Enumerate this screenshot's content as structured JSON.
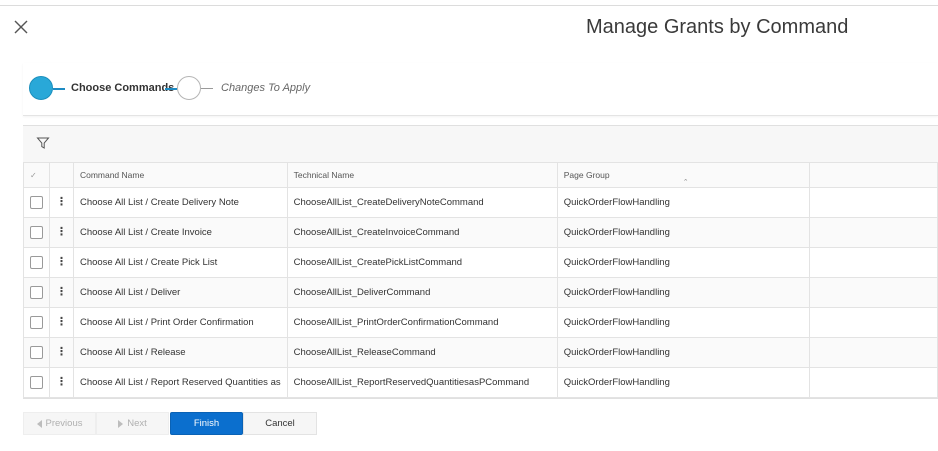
{
  "dialog": {
    "title": "Manage Grants by Command"
  },
  "stepper": {
    "steps": [
      {
        "label": "Choose Commands",
        "state": "active"
      },
      {
        "label": "Changes To Apply",
        "state": "pending"
      }
    ],
    "active_color": "#29a8d8"
  },
  "grid": {
    "columns": {
      "select": "✓",
      "command_name": "Command Name",
      "technical_name": "Technical Name",
      "page_group": "Page Group"
    },
    "sorted_column": "page_group",
    "sort_direction": "ascending",
    "rows": [
      {
        "command": "Choose All List / Create Delivery Note",
        "technical": "ChooseAllList_CreateDeliveryNoteCommand",
        "group": "QuickOrderFlowHandling"
      },
      {
        "command": "Choose All List / Create Invoice",
        "technical": "ChooseAllList_CreateInvoiceCommand",
        "group": "QuickOrderFlowHandling"
      },
      {
        "command": "Choose All List / Create Pick List",
        "technical": "ChooseAllList_CreatePickListCommand",
        "group": "QuickOrderFlowHandling"
      },
      {
        "command": "Choose All List / Deliver",
        "technical": "ChooseAllList_DeliverCommand",
        "group": "QuickOrderFlowHandling"
      },
      {
        "command": "Choose All List / Print Order Confirmation",
        "technical": "ChooseAllList_PrintOrderConfirmationCommand",
        "group": "QuickOrderFlowHandling"
      },
      {
        "command": "Choose All List / Release",
        "technical": "ChooseAllList_ReleaseCommand",
        "group": "QuickOrderFlowHandling"
      },
      {
        "command": "Choose All List / Report Reserved Quantities as",
        "technical": "ChooseAllList_ReportReservedQuantitiesasPCommand",
        "group": "QuickOrderFlowHandling"
      }
    ]
  },
  "footer": {
    "previous": "Previous",
    "next": "Next",
    "finish": "Finish",
    "cancel": "Cancel",
    "primary_color": "#0b6fce"
  }
}
